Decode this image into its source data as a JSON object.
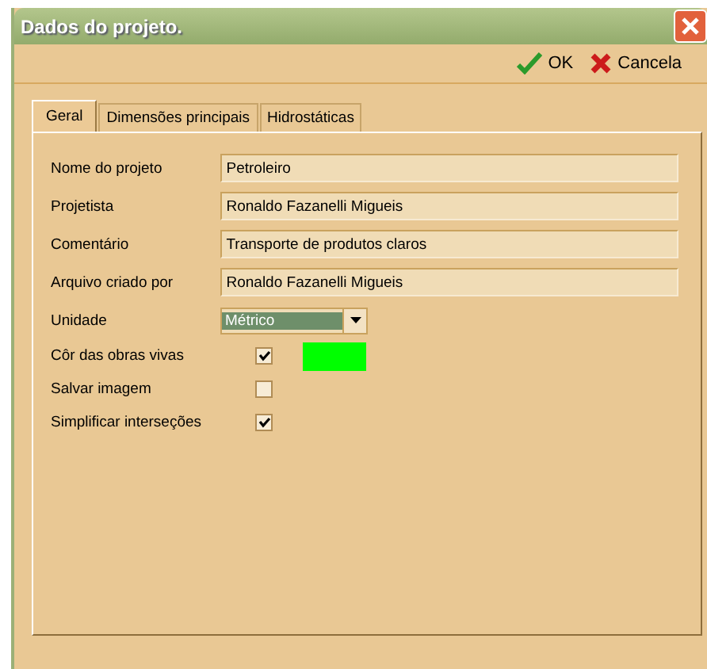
{
  "window": {
    "title": "Dados do projeto."
  },
  "toolbar": [
    {
      "kind": "ok",
      "label": "OK"
    },
    {
      "kind": "cancel",
      "label": "Cancela"
    }
  ],
  "tabs": [
    {
      "label": "Geral",
      "selected": true
    },
    {
      "label": "Dimensões principais",
      "selected": false
    },
    {
      "label": "Hidrostáticas",
      "selected": false
    }
  ],
  "fields": [
    {
      "kind": "text",
      "label": "Nome do projeto",
      "value": "Petroleiro"
    },
    {
      "kind": "text",
      "label": "Projetista",
      "value": "Ronaldo Fazanelli Migueis"
    },
    {
      "kind": "text",
      "label": "Comentário",
      "value": "Transporte de produtos claros"
    },
    {
      "kind": "text",
      "label": "Arquivo criado por",
      "value": "Ronaldo Fazanelli Migueis"
    },
    {
      "kind": "select",
      "label": "Unidade",
      "value": "Métrico"
    },
    {
      "kind": "checkbox",
      "label": "Côr das obras vivas",
      "checked": true,
      "color": "#00ff00"
    },
    {
      "kind": "checkbox",
      "label": "Salvar imagem",
      "checked": false
    },
    {
      "kind": "checkbox",
      "label": "Simplificar interseções",
      "checked": true
    }
  ]
}
